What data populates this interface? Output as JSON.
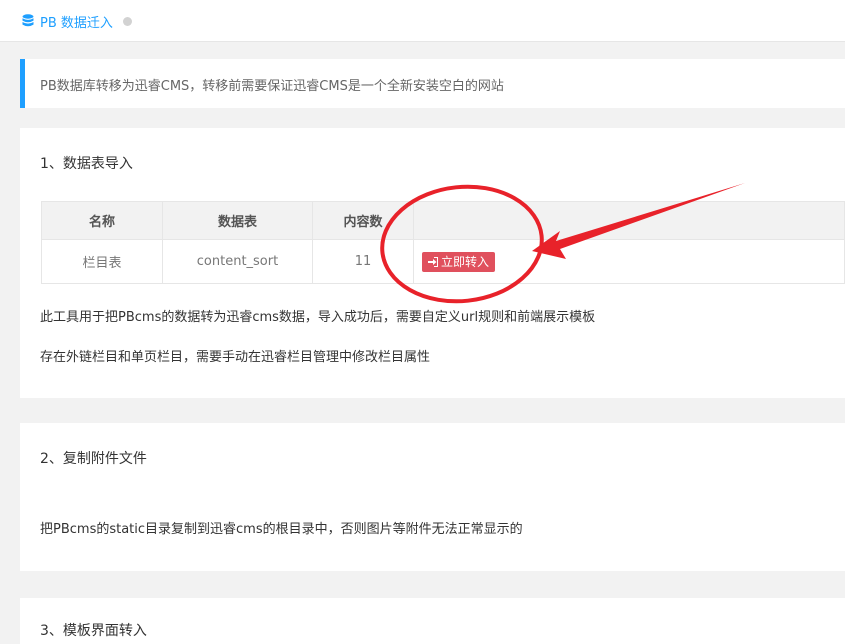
{
  "tab": {
    "title": "PB 数据迁入",
    "icon": "database-icon"
  },
  "notice": "PB数据库转移为迅睿CMS，转移前需要保证迅睿CMS是一个全新安装空白的网站",
  "section1": {
    "title": "1、数据表导入",
    "table": {
      "headers": [
        "名称",
        "数据表",
        "内容数",
        ""
      ],
      "rows": [
        {
          "name": "栏目表",
          "table": "content_sort",
          "count": "11",
          "action": "立即转入"
        }
      ]
    },
    "notes": [
      "此工具用于把PBcms的数据转为迅睿cms数据，导入成功后，需要自定义url规则和前端展示模板",
      "存在外链栏目和单页栏目，需要手动在迅睿栏目管理中修改栏目属性"
    ]
  },
  "section2": {
    "title": "2、复制附件文件",
    "note": "把PBcms的static目录复制到迅睿cms的根目录中，否则图片等附件无法正常显示的"
  },
  "section3": {
    "title": "3、模板界面转入"
  },
  "colors": {
    "accent": "#1e9fff",
    "button": "#e0505d",
    "annotation": "#e8222a"
  }
}
